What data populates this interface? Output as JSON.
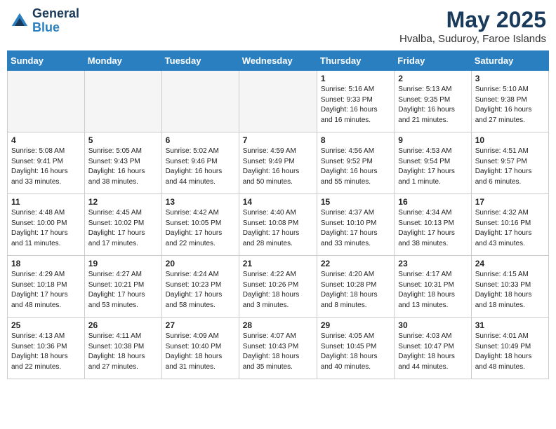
{
  "header": {
    "logo_general": "General",
    "logo_blue": "Blue",
    "month_title": "May 2025",
    "subtitle": "Hvalba, Suduroy, Faroe Islands"
  },
  "weekdays": [
    "Sunday",
    "Monday",
    "Tuesday",
    "Wednesday",
    "Thursday",
    "Friday",
    "Saturday"
  ],
  "weeks": [
    [
      {
        "day": "",
        "info": ""
      },
      {
        "day": "",
        "info": ""
      },
      {
        "day": "",
        "info": ""
      },
      {
        "day": "",
        "info": ""
      },
      {
        "day": "1",
        "info": "Sunrise: 5:16 AM\nSunset: 9:33 PM\nDaylight: 16 hours\nand 16 minutes."
      },
      {
        "day": "2",
        "info": "Sunrise: 5:13 AM\nSunset: 9:35 PM\nDaylight: 16 hours\nand 21 minutes."
      },
      {
        "day": "3",
        "info": "Sunrise: 5:10 AM\nSunset: 9:38 PM\nDaylight: 16 hours\nand 27 minutes."
      }
    ],
    [
      {
        "day": "4",
        "info": "Sunrise: 5:08 AM\nSunset: 9:41 PM\nDaylight: 16 hours\nand 33 minutes."
      },
      {
        "day": "5",
        "info": "Sunrise: 5:05 AM\nSunset: 9:43 PM\nDaylight: 16 hours\nand 38 minutes."
      },
      {
        "day": "6",
        "info": "Sunrise: 5:02 AM\nSunset: 9:46 PM\nDaylight: 16 hours\nand 44 minutes."
      },
      {
        "day": "7",
        "info": "Sunrise: 4:59 AM\nSunset: 9:49 PM\nDaylight: 16 hours\nand 50 minutes."
      },
      {
        "day": "8",
        "info": "Sunrise: 4:56 AM\nSunset: 9:52 PM\nDaylight: 16 hours\nand 55 minutes."
      },
      {
        "day": "9",
        "info": "Sunrise: 4:53 AM\nSunset: 9:54 PM\nDaylight: 17 hours\nand 1 minute."
      },
      {
        "day": "10",
        "info": "Sunrise: 4:51 AM\nSunset: 9:57 PM\nDaylight: 17 hours\nand 6 minutes."
      }
    ],
    [
      {
        "day": "11",
        "info": "Sunrise: 4:48 AM\nSunset: 10:00 PM\nDaylight: 17 hours\nand 11 minutes."
      },
      {
        "day": "12",
        "info": "Sunrise: 4:45 AM\nSunset: 10:02 PM\nDaylight: 17 hours\nand 17 minutes."
      },
      {
        "day": "13",
        "info": "Sunrise: 4:42 AM\nSunset: 10:05 PM\nDaylight: 17 hours\nand 22 minutes."
      },
      {
        "day": "14",
        "info": "Sunrise: 4:40 AM\nSunset: 10:08 PM\nDaylight: 17 hours\nand 28 minutes."
      },
      {
        "day": "15",
        "info": "Sunrise: 4:37 AM\nSunset: 10:10 PM\nDaylight: 17 hours\nand 33 minutes."
      },
      {
        "day": "16",
        "info": "Sunrise: 4:34 AM\nSunset: 10:13 PM\nDaylight: 17 hours\nand 38 minutes."
      },
      {
        "day": "17",
        "info": "Sunrise: 4:32 AM\nSunset: 10:16 PM\nDaylight: 17 hours\nand 43 minutes."
      }
    ],
    [
      {
        "day": "18",
        "info": "Sunrise: 4:29 AM\nSunset: 10:18 PM\nDaylight: 17 hours\nand 48 minutes."
      },
      {
        "day": "19",
        "info": "Sunrise: 4:27 AM\nSunset: 10:21 PM\nDaylight: 17 hours\nand 53 minutes."
      },
      {
        "day": "20",
        "info": "Sunrise: 4:24 AM\nSunset: 10:23 PM\nDaylight: 17 hours\nand 58 minutes."
      },
      {
        "day": "21",
        "info": "Sunrise: 4:22 AM\nSunset: 10:26 PM\nDaylight: 18 hours\nand 3 minutes."
      },
      {
        "day": "22",
        "info": "Sunrise: 4:20 AM\nSunset: 10:28 PM\nDaylight: 18 hours\nand 8 minutes."
      },
      {
        "day": "23",
        "info": "Sunrise: 4:17 AM\nSunset: 10:31 PM\nDaylight: 18 hours\nand 13 minutes."
      },
      {
        "day": "24",
        "info": "Sunrise: 4:15 AM\nSunset: 10:33 PM\nDaylight: 18 hours\nand 18 minutes."
      }
    ],
    [
      {
        "day": "25",
        "info": "Sunrise: 4:13 AM\nSunset: 10:36 PM\nDaylight: 18 hours\nand 22 minutes."
      },
      {
        "day": "26",
        "info": "Sunrise: 4:11 AM\nSunset: 10:38 PM\nDaylight: 18 hours\nand 27 minutes."
      },
      {
        "day": "27",
        "info": "Sunrise: 4:09 AM\nSunset: 10:40 PM\nDaylight: 18 hours\nand 31 minutes."
      },
      {
        "day": "28",
        "info": "Sunrise: 4:07 AM\nSunset: 10:43 PM\nDaylight: 18 hours\nand 35 minutes."
      },
      {
        "day": "29",
        "info": "Sunrise: 4:05 AM\nSunset: 10:45 PM\nDaylight: 18 hours\nand 40 minutes."
      },
      {
        "day": "30",
        "info": "Sunrise: 4:03 AM\nSunset: 10:47 PM\nDaylight: 18 hours\nand 44 minutes."
      },
      {
        "day": "31",
        "info": "Sunrise: 4:01 AM\nSunset: 10:49 PM\nDaylight: 18 hours\nand 48 minutes."
      }
    ]
  ]
}
